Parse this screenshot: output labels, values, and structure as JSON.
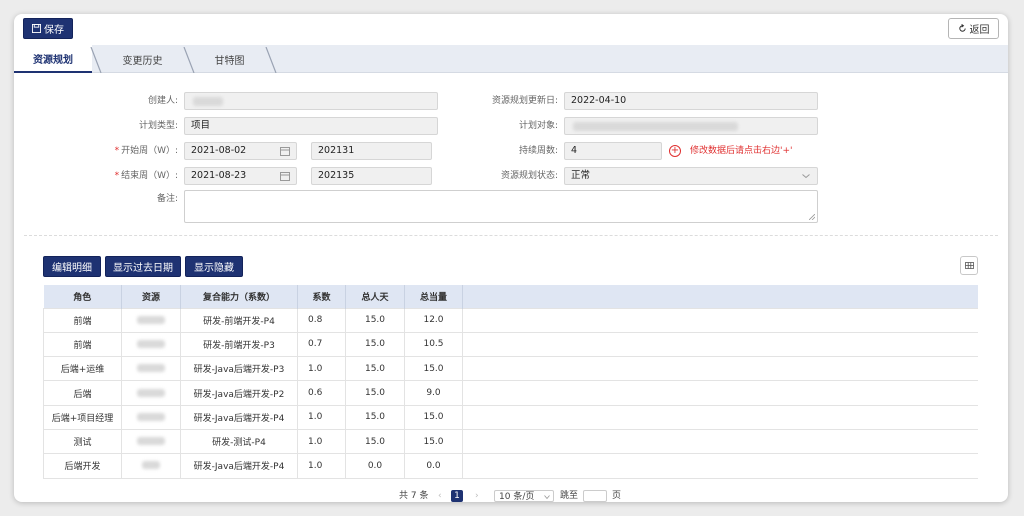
{
  "toolbar": {
    "save_label": "保存",
    "back_label": "返回"
  },
  "tabs": [
    {
      "label": "资源规划",
      "active": true
    },
    {
      "label": "变更历史",
      "active": false
    },
    {
      "label": "甘特图",
      "active": false
    }
  ],
  "form": {
    "creator_label": "创建人:",
    "update_date_label": "资源规划更新日:",
    "update_date_value": "2022-04-10",
    "plan_type_label": "计划类型:",
    "plan_type_value": "项目",
    "plan_target_label": "计划对象:",
    "start_week_label": "开始周（W）:",
    "start_date_value": "2021-08-02",
    "start_week_value": "202131",
    "duration_label": "持续周数:",
    "duration_value": "4",
    "duration_hint": "修改数据后请点击右边'+'",
    "end_week_label": "结束周（W）:",
    "end_date_value": "2021-08-23",
    "end_week_value": "202135",
    "status_label": "资源规划状态:",
    "status_value": "正常",
    "remarks_label": "备注:",
    "required_mark": "*"
  },
  "actions": {
    "edit_label": "编辑明细",
    "show_past_label": "显示过去日期",
    "show_hidden_label": "显示隐藏"
  },
  "table": {
    "headers": [
      "角色",
      "资源",
      "复合能力（系数）",
      "系数",
      "总人天",
      "总当量"
    ],
    "rows": [
      {
        "role": "前端",
        "capability": "研发-前端开发-P4",
        "coef": "0.8",
        "days": "15.0",
        "equiv": "12.0"
      },
      {
        "role": "前端",
        "capability": "研发-前端开发-P3",
        "coef": "0.7",
        "days": "15.0",
        "equiv": "10.5"
      },
      {
        "role": "后端+运维",
        "capability": "研发-Java后端开发-P3",
        "coef": "1.0",
        "days": "15.0",
        "equiv": "15.0"
      },
      {
        "role": "后端",
        "capability": "研发-Java后端开发-P2",
        "coef": "0.6",
        "days": "15.0",
        "equiv": "9.0"
      },
      {
        "role": "后端+项目经理",
        "capability": "研发-Java后端开发-P4",
        "coef": "1.0",
        "days": "15.0",
        "equiv": "15.0"
      },
      {
        "role": "测试",
        "capability": "研发-测试-P4",
        "coef": "1.0",
        "days": "15.0",
        "equiv": "15.0"
      },
      {
        "role": "后端开发",
        "capability": "研发-Java后端开发-P4",
        "coef": "1.0",
        "days": "0.0",
        "equiv": "0.0"
      }
    ]
  },
  "pager": {
    "total_label": "共 7 条",
    "current_page": "1",
    "page_size": "10 条/页",
    "jump_label": "跳至",
    "page_unit": "页"
  },
  "colors": {
    "primary": "#1e3272",
    "danger": "#e03030",
    "header_bg": "#dfe6f3"
  }
}
